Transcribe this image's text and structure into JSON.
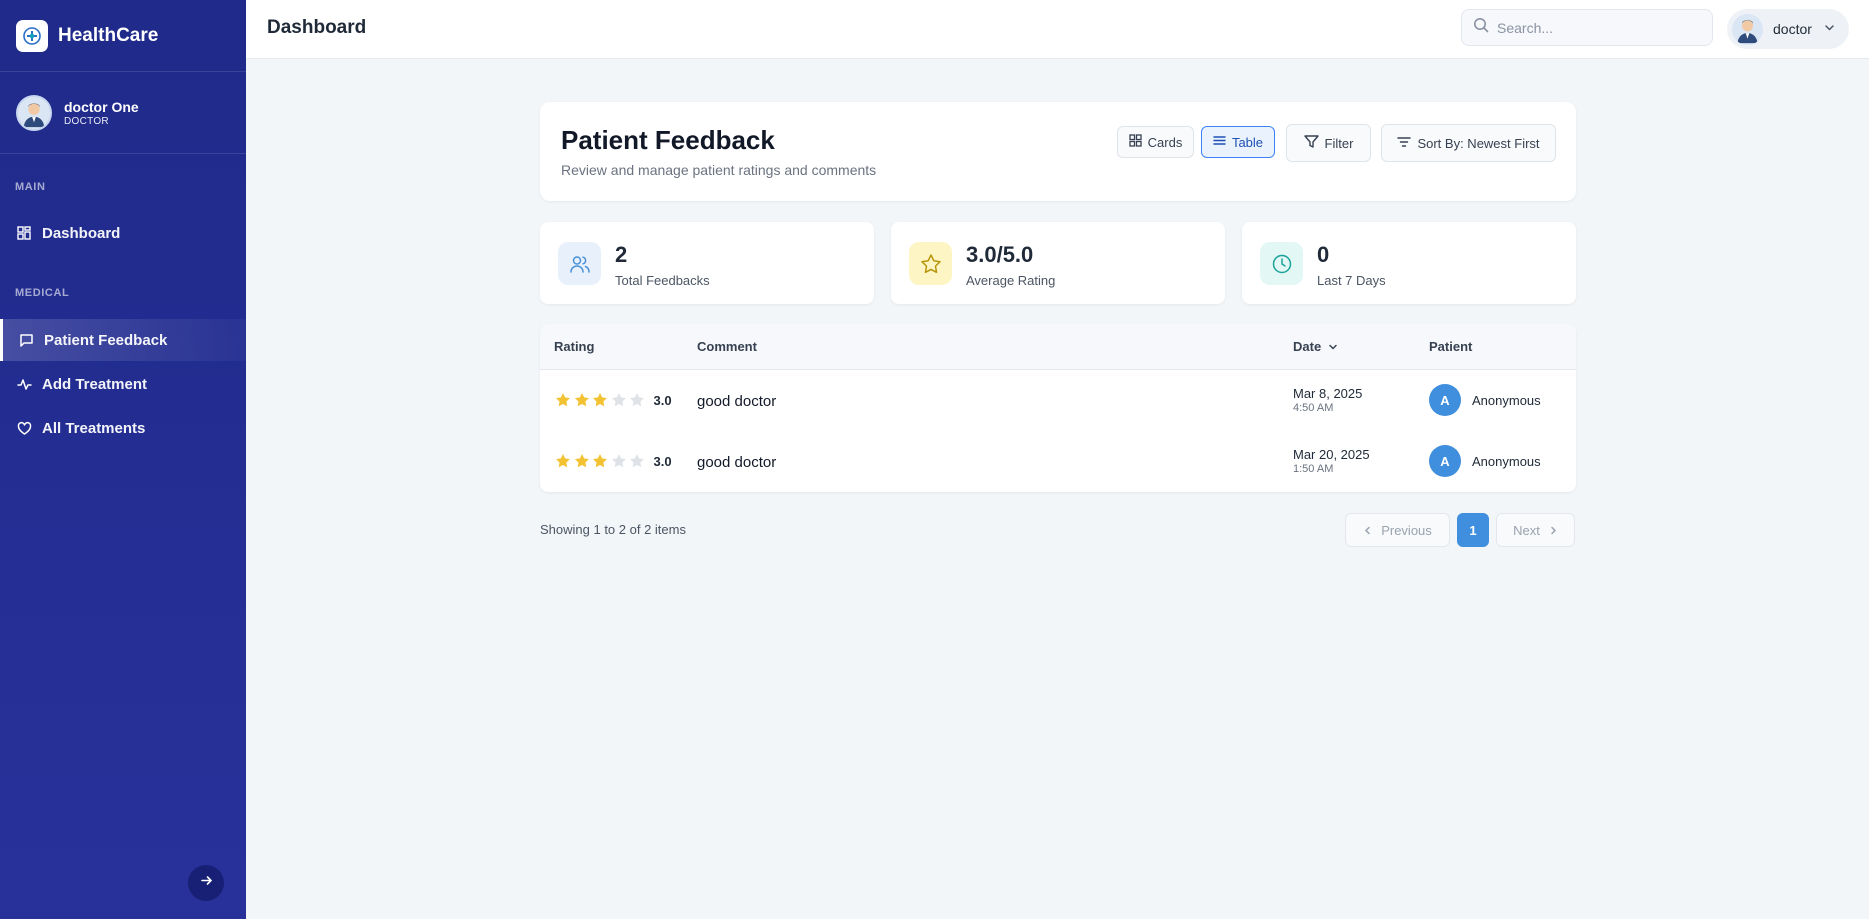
{
  "app": {
    "name": "HealthCare",
    "logo_icon": "health-logo-icon"
  },
  "sidebar": {
    "user": {
      "name": "doctor One",
      "role": "DOCTOR"
    },
    "sections": [
      {
        "title": "MAIN",
        "items": [
          {
            "label": "Dashboard",
            "icon": "grid-icon"
          }
        ]
      },
      {
        "title": "MEDICAL",
        "items": [
          {
            "label": "Patient Feedback",
            "icon": "message-icon",
            "active": true
          },
          {
            "label": "Add Treatment",
            "icon": "activity-icon"
          },
          {
            "label": "All Treatments",
            "icon": "heart-icon"
          }
        ]
      }
    ],
    "collapse_icon": "arrow-right-icon"
  },
  "header": {
    "title": "Dashboard",
    "search_placeholder": "Search...",
    "user_name": "doctor"
  },
  "page": {
    "title": "Patient Feedback",
    "subtitle": "Review and manage patient ratings and comments",
    "buttons": {
      "cards": "Cards",
      "table": "Table",
      "filter": "Filter",
      "sort": "Sort By: Newest First"
    },
    "view_mode": "Table"
  },
  "stats": [
    {
      "value": "2",
      "label": "Total Feedbacks",
      "icon": "users-icon",
      "color": "#4a90d9",
      "bg": "#e8f1fb"
    },
    {
      "value": "3.0/5.0",
      "label": "Average Rating",
      "icon": "star-icon",
      "color": "#b7950b",
      "bg": "#fdf6c4"
    },
    {
      "value": "0",
      "label": "Last 7 Days",
      "icon": "clock-icon",
      "color": "#1aa39a",
      "bg": "#e3f7f4"
    }
  ],
  "table": {
    "columns": {
      "rating": "Rating",
      "comment": "Comment",
      "date": "Date",
      "patient": "Patient"
    },
    "rows": [
      {
        "rating": 3,
        "rating_text": "3.0",
        "comment": "good doctor",
        "date": "Mar 8, 2025",
        "time": "4:50 AM",
        "patient_initial": "A",
        "patient": "Anonymous"
      },
      {
        "rating": 3,
        "rating_text": "3.0",
        "comment": "good doctor",
        "date": "Mar 20, 2025",
        "time": "1:50 AM",
        "patient_initial": "A",
        "patient": "Anonymous"
      }
    ]
  },
  "pagination": {
    "summary": "Showing 1 to 2 of 2 items",
    "previous": "Previous",
    "current_page": "1",
    "next": "Next"
  },
  "colors": {
    "sidebar_bg": "#1f2a8a",
    "accent": "#3f8fde",
    "star_filled": "#f2c232",
    "star_empty": "#dfe3e8"
  }
}
